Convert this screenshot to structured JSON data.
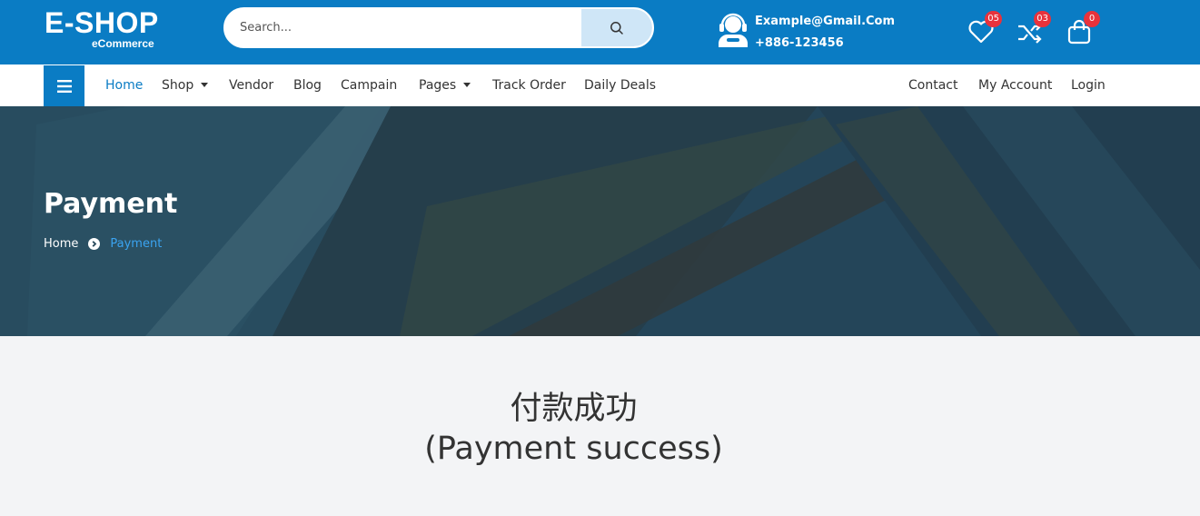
{
  "header": {
    "logo_main": "E-SHOP",
    "logo_sub": "eCommerce",
    "search_placeholder": "Search...",
    "email": "Example@Gmail.Com",
    "phone": "+886-123456",
    "wishlist_count": "05",
    "compare_count": "03",
    "cart_count": "0"
  },
  "nav": {
    "items": [
      "Home",
      "Shop",
      "Vendor",
      "Blog",
      "Campain",
      "Pages",
      "Track Order",
      "Daily Deals"
    ],
    "right_items": [
      "Contact",
      "My Account",
      "Login"
    ],
    "active": "Home"
  },
  "banner": {
    "title": "Payment",
    "breadcrumb_home": "Home",
    "breadcrumb_current": "Payment"
  },
  "main": {
    "message_line1": "付款成功",
    "message_line2": "(Payment success)"
  },
  "colors": {
    "brand": "#0a7cc4",
    "badge": "#e8323c",
    "breadcrumb_active": "#3aa3f0",
    "page_bg": "#f3f4f6"
  },
  "icons": {
    "search": "search-icon",
    "support": "support-agent-icon",
    "wishlist": "heart-icon",
    "compare": "shuffle-icon",
    "cart": "shopping-bag-icon",
    "menu": "hamburger-menu-icon",
    "breadcrumb_separator": "chevron-circle-right-icon"
  }
}
